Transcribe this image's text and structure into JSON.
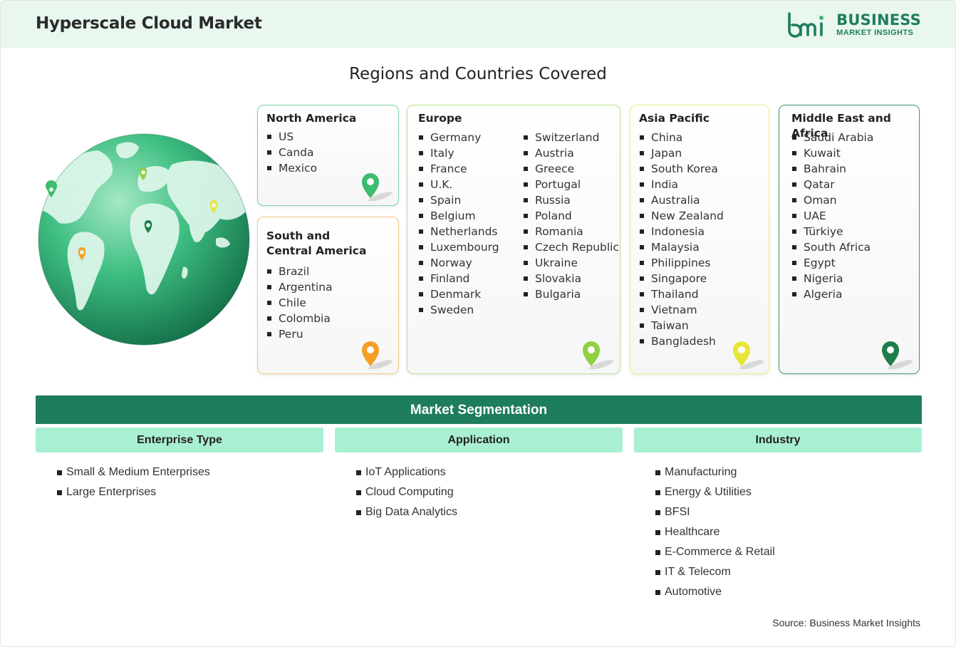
{
  "header": {
    "title": "Hyperscale Cloud Market",
    "logo_line1": "BUSINESS",
    "logo_line2": "MARKET INSIGHTS",
    "logo_mark": "bmi"
  },
  "regions_title": "Regions and Countries Covered",
  "regions": {
    "north_america": {
      "name": "North America",
      "countries": [
        "US",
        "Canda",
        "Mexico"
      ],
      "pin_color": "#3dbb6e"
    },
    "south_america": {
      "name": "South and Central America",
      "name_lines": [
        "South and",
        "Central America"
      ],
      "countries": [
        "Brazil",
        "Argentina",
        "Chile",
        "Colombia",
        "Peru"
      ],
      "pin_color": "#f4a024"
    },
    "europe": {
      "name": "Europe",
      "countries_col1": [
        "Germany",
        "Italy",
        "France",
        "U.K.",
        "Spain",
        "Belgium",
        "Netherlands",
        "Luxembourg",
        "Norway",
        "Finland",
        "Denmark",
        "Sweden"
      ],
      "countries_col2": [
        "Switzerland",
        "Austria",
        "Greece",
        "Portugal",
        "Russia",
        "Poland",
        "Romania",
        "Czech Republic",
        "Ukraine",
        "Slovakia",
        "Bulgaria"
      ],
      "pin_color": "#8fd13f"
    },
    "asia_pacific": {
      "name": "Asia Pacific",
      "countries": [
        "China",
        "Japan",
        "South Korea",
        "India",
        "Australia",
        "New Zealand",
        "Indonesia",
        "Malaysia",
        "Philippines",
        "Singapore",
        "Thailand",
        "Vietnam",
        "Taiwan",
        "Bangladesh"
      ],
      "pin_color": "#e6e63a"
    },
    "mea": {
      "name": "Middle East and Africa",
      "countries": [
        "Saudi Arabia",
        "Kuwait",
        "Bahrain",
        "Qatar",
        "Oman",
        "UAE",
        "Türkiye",
        "South Africa",
        "Egypt",
        "Nigeria",
        "Algeria"
      ],
      "pin_color": "#1e7d4a"
    }
  },
  "segmentation": {
    "title": "Market Segmentation",
    "columns": [
      {
        "heading": "Enterprise Type",
        "items": [
          "Small & Medium Enterprises",
          "Large Enterprises"
        ]
      },
      {
        "heading": "Application",
        "items": [
          "IoT Applications",
          "Cloud Computing",
          "Big Data Analytics"
        ]
      },
      {
        "heading": "Industry",
        "items": [
          "Manufacturing",
          "Energy & Utilities",
          "BFSI",
          "Healthcare",
          "E-Commerce & Retail",
          "IT & Telecom",
          "Automotive"
        ]
      }
    ]
  },
  "source": "Source: Business Market Insights",
  "colors": {
    "brand_green": "#1e7d5c",
    "header_bg": "#e9f7ef",
    "segment_head_bg": "#a9f0d3",
    "na_border": "#7fd6a4",
    "sa_border": "#f5c684",
    "eu_border": "#b5e38a",
    "ap_border": "#ecec8a",
    "mea_border": "#3c9a6a"
  }
}
